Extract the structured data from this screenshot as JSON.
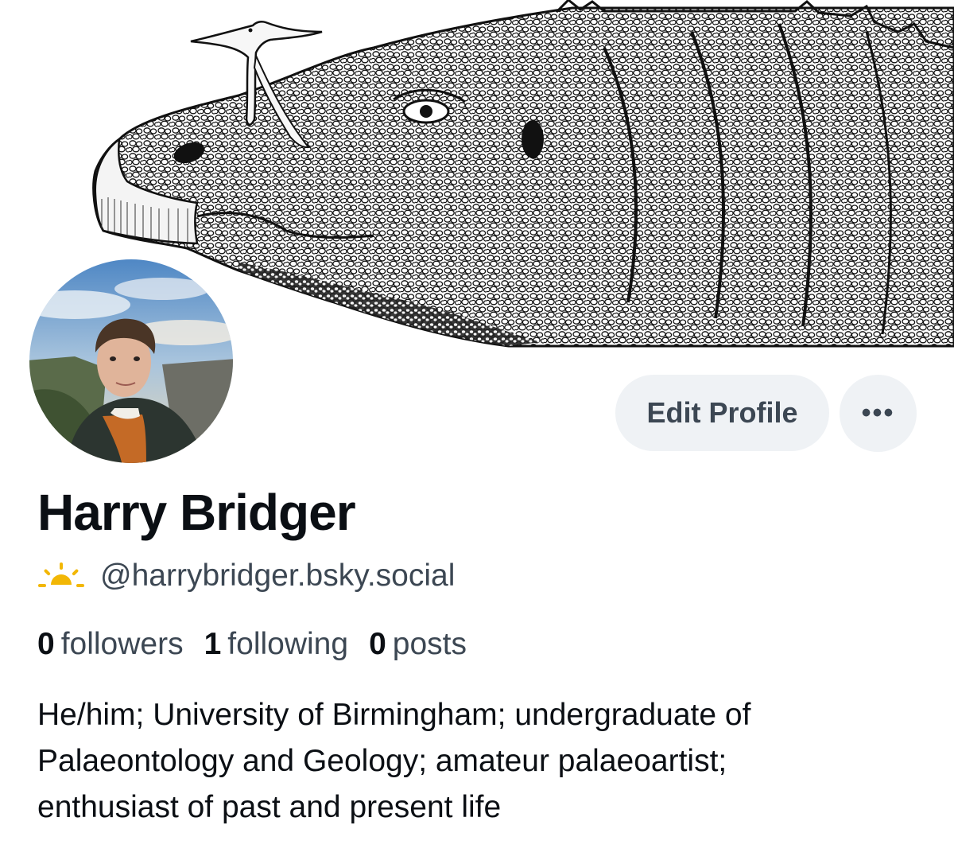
{
  "profile": {
    "display_name": "Harry Bridger",
    "handle": "@harrybridger.bsky.social",
    "handle_icon": "sun-rising-icon",
    "bio_lines": [
      "He/him; University of Birmingham; undergraduate of",
      "Palaeontology and Geology; amateur palaeoartist;",
      "enthusiast of past and present life"
    ]
  },
  "stats": {
    "followers_count": "0",
    "followers_label": "followers",
    "following_count": "1",
    "following_label": "following",
    "posts_count": "0",
    "posts_label": "posts"
  },
  "actions": {
    "edit_profile_label": "Edit Profile",
    "more_label": "•••"
  },
  "colors": {
    "accent_sun": "#f2b705",
    "secondary_text": "#3c4753",
    "button_bg": "#eff2f5"
  }
}
